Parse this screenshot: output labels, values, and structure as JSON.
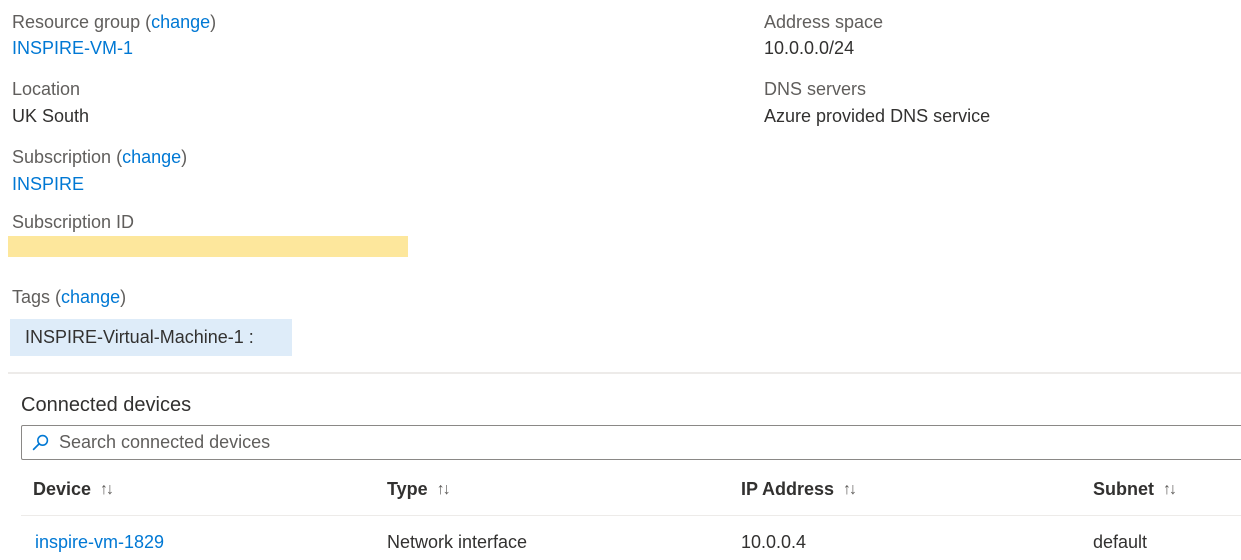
{
  "essentials": {
    "resource_group": {
      "label": "Resource group",
      "change": "change",
      "value": "INSPIRE-VM-1"
    },
    "location": {
      "label": "Location",
      "value": "UK South"
    },
    "subscription": {
      "label": "Subscription",
      "change": "change",
      "value": "INSPIRE"
    },
    "subscription_id": {
      "label": "Subscription ID",
      "value": ""
    },
    "address_space": {
      "label": "Address space",
      "value": "10.0.0.0/24"
    },
    "dns_servers": {
      "label": "DNS servers",
      "value": "Azure provided DNS service"
    },
    "tags": {
      "label": "Tags",
      "change": "change",
      "items": [
        "INSPIRE-Virtual-Machine-1 :"
      ]
    }
  },
  "connected_devices": {
    "title": "Connected devices",
    "search": {
      "placeholder": "Search connected devices",
      "value": ""
    },
    "columns": [
      "Device",
      "Type",
      "IP Address",
      "Subnet"
    ],
    "sort_icon": "↑↓",
    "rows": [
      [
        "inspire-vm-1829",
        "Network interface",
        "10.0.0.4",
        "default"
      ]
    ]
  },
  "colors": {
    "link": "#0078d4",
    "label": "#605e5c",
    "tag_background": "#deecf9",
    "redaction": "#fde79c"
  },
  "icons": {
    "search": "search-icon",
    "sort": "sort-icon"
  }
}
